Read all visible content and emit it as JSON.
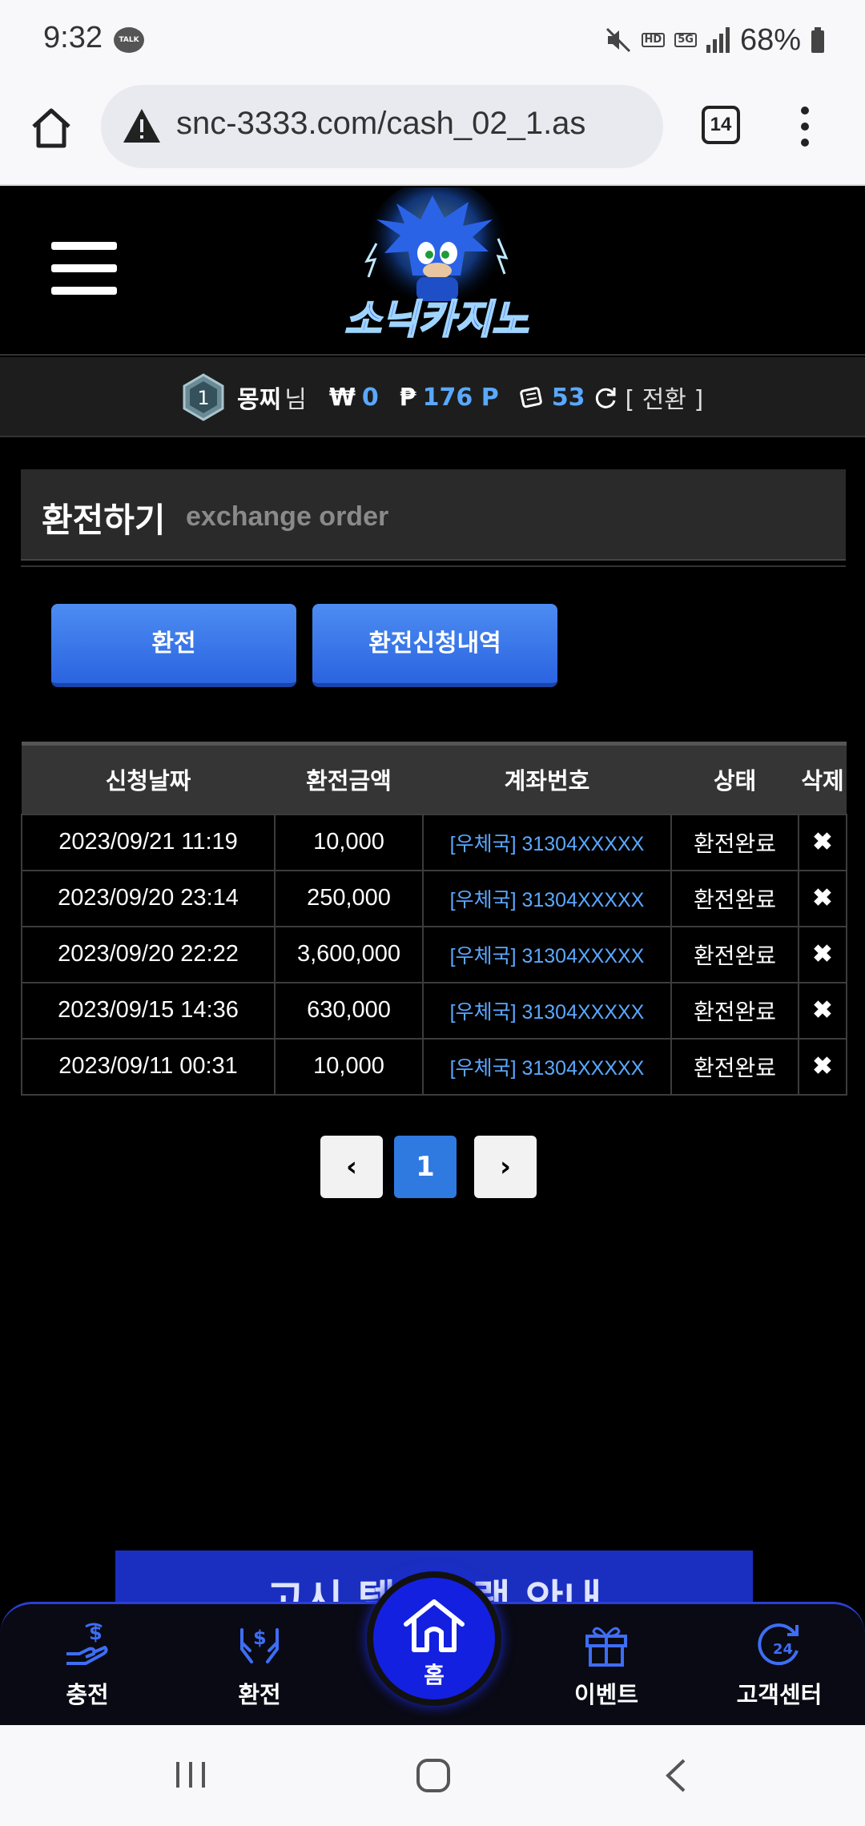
{
  "status_bar": {
    "time": "9:32",
    "talk_badge": "TALK",
    "hd_badge": "HD",
    "network_badge": "5G",
    "battery": "68%"
  },
  "browser": {
    "url": "snc-3333.com/cash_02_1.as",
    "tab_count": "14"
  },
  "header": {
    "logo_text": "소닉카지노"
  },
  "user": {
    "level": "1",
    "name": "몽찌",
    "suffix": "님",
    "won_symbol": "₩",
    "won": "0",
    "point_symbol": "₱",
    "points": "176 P",
    "chips": "53",
    "switch_label": "[ 전환 ]"
  },
  "section": {
    "title_kr": "환전하기",
    "title_en": "exchange order"
  },
  "buttons": {
    "exchange": "환전",
    "history": "환전신청내역"
  },
  "table": {
    "headers": [
      "신청날짜",
      "환전금액",
      "계좌번호",
      "상태",
      "삭제"
    ],
    "rows": [
      {
        "date": "2023/09/21 11:19",
        "amount": "10,000",
        "account": "[우체국] 31304XXXXX",
        "status": "환전완료",
        "delete": "✖"
      },
      {
        "date": "2023/09/20 23:14",
        "amount": "250,000",
        "account": "[우체국] 31304XXXXX",
        "status": "환전완료",
        "delete": "✖"
      },
      {
        "date": "2023/09/20 22:22",
        "amount": "3,600,000",
        "account": "[우체국] 31304XXXXX",
        "status": "환전완료",
        "delete": "✖"
      },
      {
        "date": "2023/09/15 14:36",
        "amount": "630,000",
        "account": "[우체국] 31304XXXXX",
        "status": "환전완료",
        "delete": "✖"
      },
      {
        "date": "2023/09/11 00:31",
        "amount": "10,000",
        "account": "[우체국] 31304XXXXX",
        "status": "환전완료",
        "delete": "✖"
      }
    ]
  },
  "pagination": {
    "prev": "‹",
    "current": "1",
    "next": "›"
  },
  "banner": {
    "text": "고시 텔레그램 안내"
  },
  "bottom_nav": {
    "deposit": "충전",
    "exchange": "환전",
    "home": "홈",
    "event": "이벤트",
    "support": "고객센터"
  },
  "colors": {
    "accent_blue": "#2f7ae0",
    "link_blue": "#5aa8ff",
    "nav_blue": "#1420e0"
  }
}
